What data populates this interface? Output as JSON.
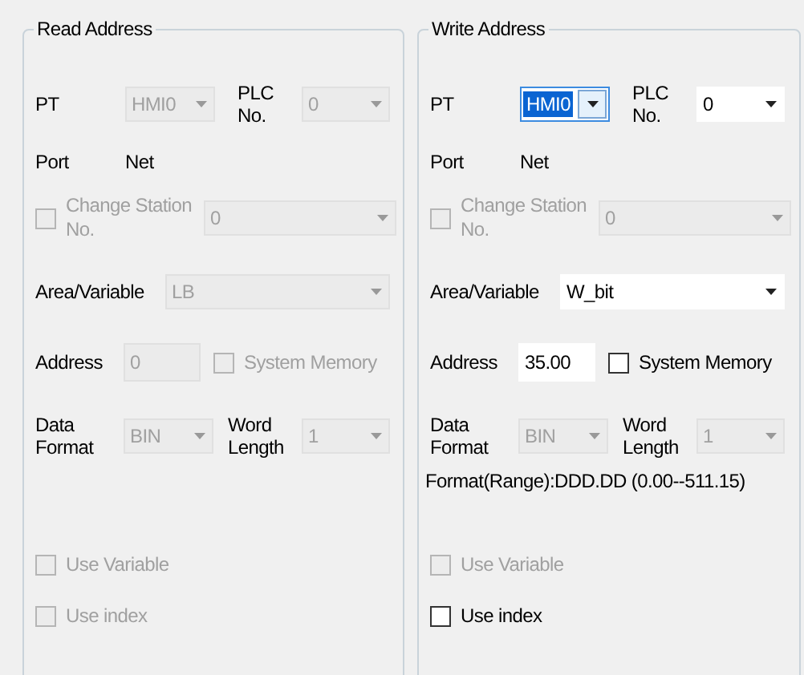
{
  "panels": [
    {
      "title": "Read Address",
      "pt": {
        "label": "PT",
        "value": "HMI0",
        "disabled": true,
        "focused": false
      },
      "plc": {
        "label": "PLC No.",
        "value": "0",
        "disabled": true
      },
      "port": {
        "label": "Port",
        "value": "Net"
      },
      "station": {
        "label": "Change Station No.",
        "checked": false,
        "disabled": true,
        "value": "0"
      },
      "area": {
        "label": "Area/Variable",
        "value": "LB",
        "disabled": true
      },
      "address": {
        "label": "Address",
        "value": "0",
        "disabled": true
      },
      "system_memory": {
        "label": "System Memory",
        "checked": false,
        "disabled": true
      },
      "data_format": {
        "label": "Data Format",
        "value": "BIN",
        "disabled": true
      },
      "word_length": {
        "label": "Word Length",
        "value": "1",
        "disabled": true
      },
      "use_variable": {
        "label": "Use Variable",
        "checked": false,
        "disabled": true
      },
      "use_index": {
        "label": "Use index",
        "checked": false,
        "disabled": true
      }
    },
    {
      "title": "Write Address",
      "pt": {
        "label": "PT",
        "value": "HMI0",
        "disabled": false,
        "focused": true
      },
      "plc": {
        "label": "PLC No.",
        "value": "0",
        "disabled": false
      },
      "port": {
        "label": "Port",
        "value": "Net"
      },
      "station": {
        "label": "Change Station No.",
        "checked": false,
        "disabled": true,
        "value": "0"
      },
      "area": {
        "label": "Area/Variable",
        "value": "W_bit",
        "disabled": false
      },
      "address": {
        "label": "Address",
        "value": "35.00",
        "disabled": false
      },
      "system_memory": {
        "label": "System Memory",
        "checked": false,
        "disabled": false
      },
      "data_format": {
        "label": "Data Format",
        "value": "BIN",
        "disabled": true
      },
      "word_length": {
        "label": "Word Length",
        "value": "1",
        "disabled": true
      },
      "format_range": "Format(Range):DDD.DD (0.00--511.15)",
      "use_variable": {
        "label": "Use Variable",
        "checked": false,
        "disabled": true
      },
      "use_index": {
        "label": "Use index",
        "checked": false,
        "disabled": false
      }
    }
  ]
}
